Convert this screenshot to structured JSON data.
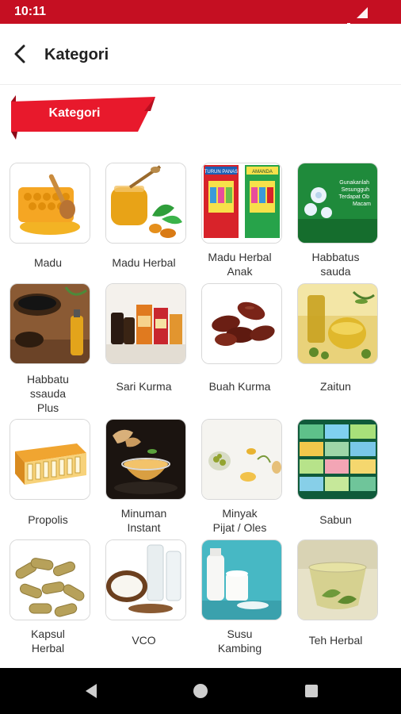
{
  "status_bar": {
    "time": "10:11"
  },
  "header": {
    "title": "Kategori"
  },
  "section": {
    "label": "Kategori"
  },
  "categories": [
    {
      "label": "Madu",
      "icon": "honeycomb"
    },
    {
      "label": "Madu Herbal",
      "icon": "honey-jar"
    },
    {
      "label": "Madu Herbal\nAnak",
      "icon": "kids-honey-boxes"
    },
    {
      "label": "Habbatus\nsauda",
      "icon": "nigella-flowers"
    },
    {
      "label": "Habbatu\nssauda\nPlus",
      "icon": "black-seeds"
    },
    {
      "label": "Sari Kurma",
      "icon": "date-extract-bottles"
    },
    {
      "label": "Buah Kurma",
      "icon": "dates"
    },
    {
      "label": "Zaitun",
      "icon": "olive-oil"
    },
    {
      "label": "Propolis",
      "icon": "propolis-box"
    },
    {
      "label": "Minuman\nInstant",
      "icon": "ginger-tea"
    },
    {
      "label": "Minyak\nPijat / Oles",
      "icon": "massage-oil"
    },
    {
      "label": "Sabun",
      "icon": "soap-bars"
    },
    {
      "label": "Kapsul\nHerbal",
      "icon": "capsules"
    },
    {
      "label": "VCO",
      "icon": "coconut-oil"
    },
    {
      "label": "Susu\nKambing",
      "icon": "goat-milk"
    },
    {
      "label": "Teh Herbal",
      "icon": "herbal-tea"
    }
  ],
  "thumb_text": {
    "kids_box_top": "TURUN PANAS",
    "kids_box_brand": "AMANDA",
    "nigella_caption": "Gunakanlah\nSesungguh\nTerdapat Ob\nMacam"
  },
  "colors": {
    "brand_red": "#c50f22",
    "banner_red": "#e8192c",
    "nav_black": "#000000"
  }
}
